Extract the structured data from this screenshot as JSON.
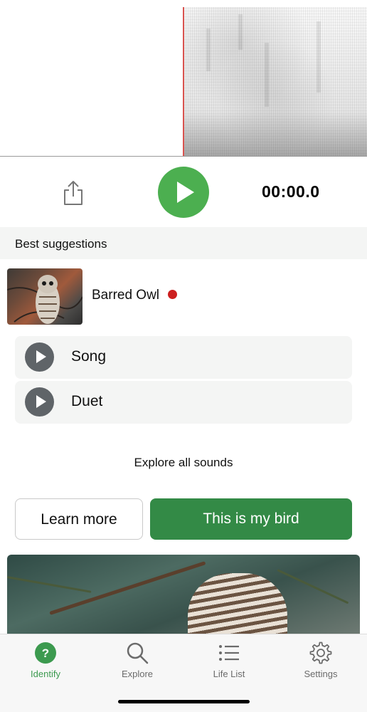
{
  "player": {
    "timer": "00:00.0"
  },
  "suggestions": {
    "header": "Best suggestions",
    "species": {
      "name": "Barred Owl",
      "sounds": [
        {
          "label": "Song"
        },
        {
          "label": "Duet"
        }
      ]
    },
    "explore_all": "Explore all sounds",
    "learn_more": "Learn more",
    "this_is_my_bird": "This is my bird"
  },
  "tabbar": {
    "tabs": [
      {
        "label": "Identify",
        "icon": "question-circle-icon",
        "active": true
      },
      {
        "label": "Explore",
        "icon": "search-icon",
        "active": false
      },
      {
        "label": "Life List",
        "icon": "list-icon",
        "active": false
      },
      {
        "label": "Settings",
        "icon": "gear-icon",
        "active": false
      }
    ]
  },
  "colors": {
    "accent_green": "#4caf50",
    "button_green": "#338a46",
    "active_tab": "#3c9a4f",
    "seen_dot": "#cc1f1f",
    "playhead": "#d9534f"
  }
}
